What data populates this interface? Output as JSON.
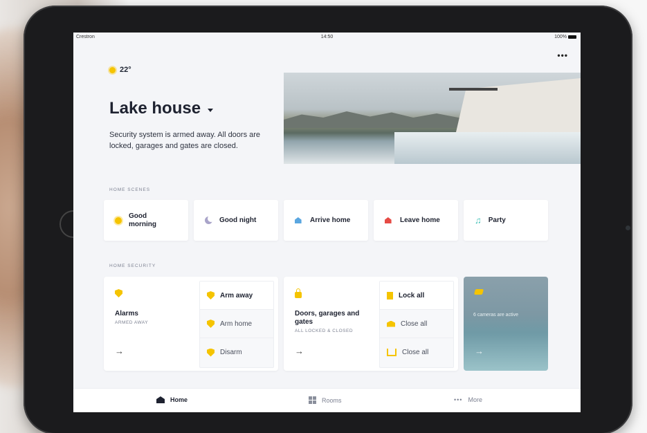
{
  "status_bar": {
    "carrier": "Crestron",
    "time": "14:50",
    "battery": "100%"
  },
  "overflow_menu": "•••",
  "weather": {
    "temperature": "22°",
    "icon": "sun-icon"
  },
  "location": {
    "title": "Lake house",
    "description": "Security system is armed away. All doors are locked, garages and gates are closed."
  },
  "scenes_section": {
    "label": "HOME SCENES",
    "items": [
      {
        "label": "Good morning",
        "icon": "sun-icon"
      },
      {
        "label": "Good night",
        "icon": "moon-icon"
      },
      {
        "label": "Arrive home",
        "icon": "arrive-home-icon"
      },
      {
        "label": "Leave home",
        "icon": "leave-home-icon"
      },
      {
        "label": "Party",
        "icon": "music-note-icon"
      }
    ]
  },
  "security_section": {
    "label": "HOME SECURITY",
    "alarms": {
      "name": "Alarms",
      "status": "ARMED AWAY",
      "actions": [
        {
          "label": "Arm away"
        },
        {
          "label": "Arm home"
        },
        {
          "label": "Disarm"
        }
      ]
    },
    "doors": {
      "name": "Doors, garages and gates",
      "status": "ALL LOCKED & CLOSED",
      "actions": [
        {
          "label": "Lock all"
        },
        {
          "label": "Close all"
        },
        {
          "label": "Close all"
        }
      ]
    },
    "cameras": {
      "text": "6 cameras are active"
    }
  },
  "tab_bar": {
    "items": [
      {
        "label": "Home",
        "icon": "home-icon"
      },
      {
        "label": "Rooms",
        "icon": "rooms-icon"
      },
      {
        "label": "More",
        "icon": "more-icon"
      }
    ]
  },
  "colors": {
    "accent": "#f5c400",
    "text_dark": "#1e2230",
    "arrive": "#5aa6e0",
    "leave": "#e64b45",
    "party": "#41c0b6"
  }
}
